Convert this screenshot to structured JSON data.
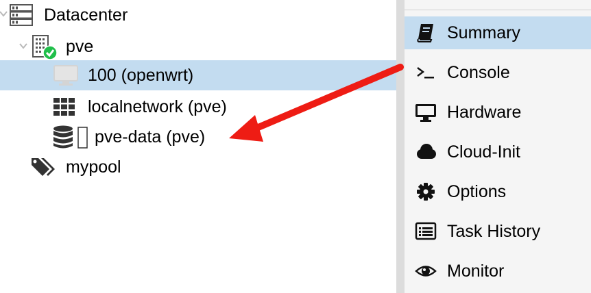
{
  "tree": {
    "datacenter": {
      "label": "Datacenter",
      "icon": "server-rack-icon"
    },
    "node": {
      "label": "pve",
      "icon": "node-online-icon",
      "status_color": "#21bf4b"
    },
    "vm": {
      "label": "100 (openwrt)",
      "icon": "monitor-icon"
    },
    "sdn": {
      "label": "localnetwork (pve)",
      "icon": "network-grid-icon"
    },
    "storage": {
      "label": "pve-data (pve)",
      "icon": "database-icon"
    },
    "pool": {
      "label": "mypool",
      "icon": "tags-icon"
    }
  },
  "menu": {
    "items": [
      {
        "label": "Summary",
        "icon": "book-icon",
        "active": true
      },
      {
        "label": "Console",
        "icon": "terminal-icon"
      },
      {
        "label": "Hardware",
        "icon": "desktop-icon"
      },
      {
        "label": "Cloud-Init",
        "icon": "cloud-icon"
      },
      {
        "label": "Options",
        "icon": "gear-icon"
      },
      {
        "label": "Task History",
        "icon": "list-alt-icon"
      },
      {
        "label": "Monitor",
        "icon": "eye-icon"
      }
    ]
  },
  "colors": {
    "selected": "#c3dcf0",
    "arrow": "#ee1c14"
  }
}
